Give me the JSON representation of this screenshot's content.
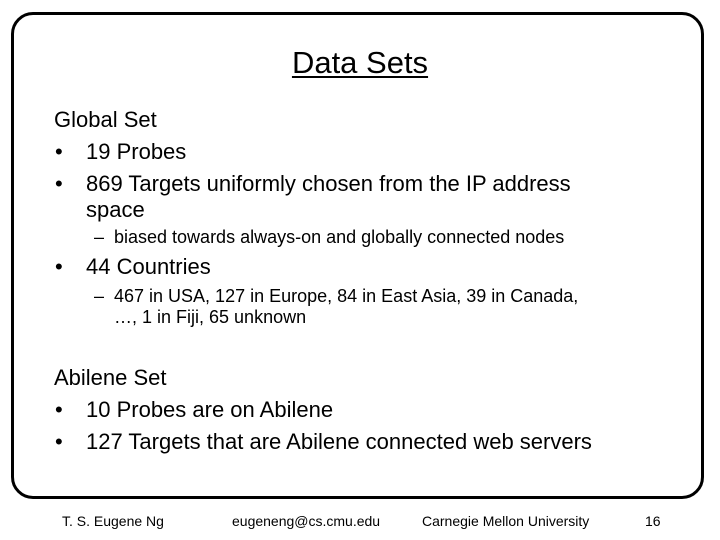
{
  "slide": {
    "title": "Data Sets",
    "global_set": {
      "heading": "Global Set",
      "bullets": [
        {
          "marker": "•",
          "lines": [
            "19 Probes"
          ]
        },
        {
          "marker": "•",
          "lines": [
            "869 Targets uniformly chosen from the IP address",
            "space"
          ],
          "sub": {
            "marker": "–",
            "lines": [
              "biased towards always-on and globally connected nodes"
            ]
          }
        },
        {
          "marker": "•",
          "lines": [
            "44 Countries"
          ],
          "sub": {
            "marker": "–",
            "lines": [
              "467 in USA, 127 in Europe, 84 in East Asia, 39 in Canada,",
              "…, 1 in Fiji, 65 unknown"
            ]
          }
        }
      ]
    },
    "abilene_set": {
      "heading": "Abilene Set",
      "bullets": [
        {
          "marker": "•",
          "lines": [
            "10 Probes are on Abilene"
          ]
        },
        {
          "marker": "•",
          "lines": [
            "127 Targets that are Abilene connected web servers"
          ]
        }
      ]
    }
  },
  "footer": {
    "author": "T. S. Eugene Ng",
    "email": "eugeneng@cs.cmu.edu",
    "institution": "Carnegie Mellon University",
    "page_number": "16"
  }
}
